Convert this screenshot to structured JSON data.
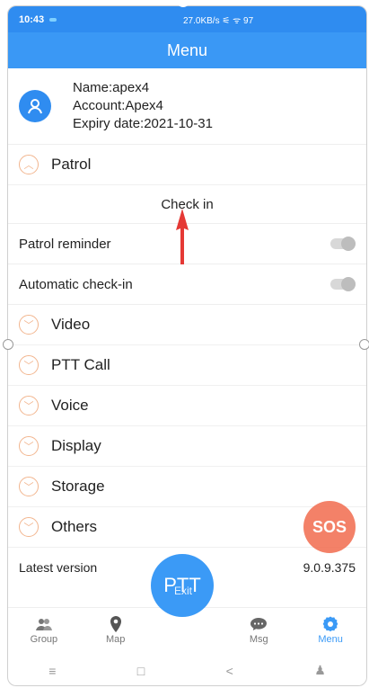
{
  "status_bar": {
    "time": "10:43",
    "right": "27.0KB/s ⚟ ᯤ 97"
  },
  "header": {
    "title": "Menu"
  },
  "user": {
    "name": "Name:apex4",
    "account": "Account:Apex4",
    "expiry": "Expiry date:2021-10-31"
  },
  "patrol": {
    "title": "Patrol",
    "check_in": "Check in",
    "reminder_label": "Patrol reminder",
    "reminder_on": false,
    "auto_label": "Automatic check-in",
    "auto_on": false
  },
  "sections": [
    "Video",
    "PTT Call",
    "Voice",
    "Display",
    "Storage",
    "Others"
  ],
  "version": {
    "label": "Latest version",
    "value": "9.0.9.375"
  },
  "buttons": {
    "sos": "SOS",
    "exit": "Exit",
    "ptt": "PTT"
  },
  "tabs": [
    {
      "label": "Group",
      "icon": "group-icon",
      "active": false
    },
    {
      "label": "Map",
      "icon": "map-pin-icon",
      "active": false
    },
    {
      "label": "",
      "icon": "",
      "active": false
    },
    {
      "label": "Msg",
      "icon": "message-icon",
      "active": false
    },
    {
      "label": "Menu",
      "icon": "gear-icon",
      "active": true
    }
  ],
  "navbar": {
    "menu": "≡",
    "home": "□",
    "back": "<",
    "accessibility": "♟"
  },
  "colors": {
    "primary": "#3a98f5",
    "sos": "#f26c4e",
    "accent_chevron": "#f2b58e",
    "arrow": "#e53935"
  }
}
